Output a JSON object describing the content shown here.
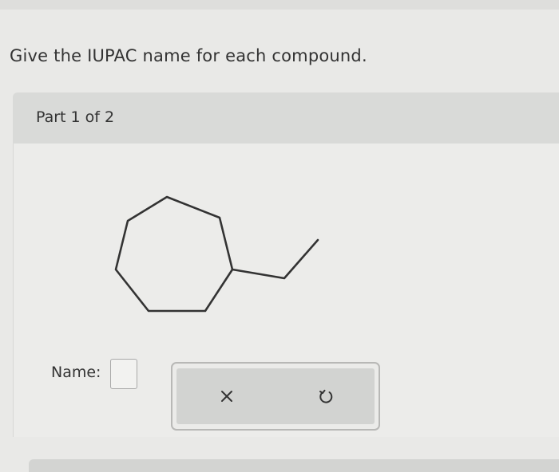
{
  "question": {
    "text": "Give the IUPAC name for each compound."
  },
  "part": {
    "label": "Part 1 of 2"
  },
  "molecule": {
    "structure": "ethylcycloheptane skeletal drawing"
  },
  "answer": {
    "name_label": "Name:",
    "value": ""
  },
  "actions": {
    "clear_icon": "x-icon",
    "undo_icon": "undo-icon"
  }
}
